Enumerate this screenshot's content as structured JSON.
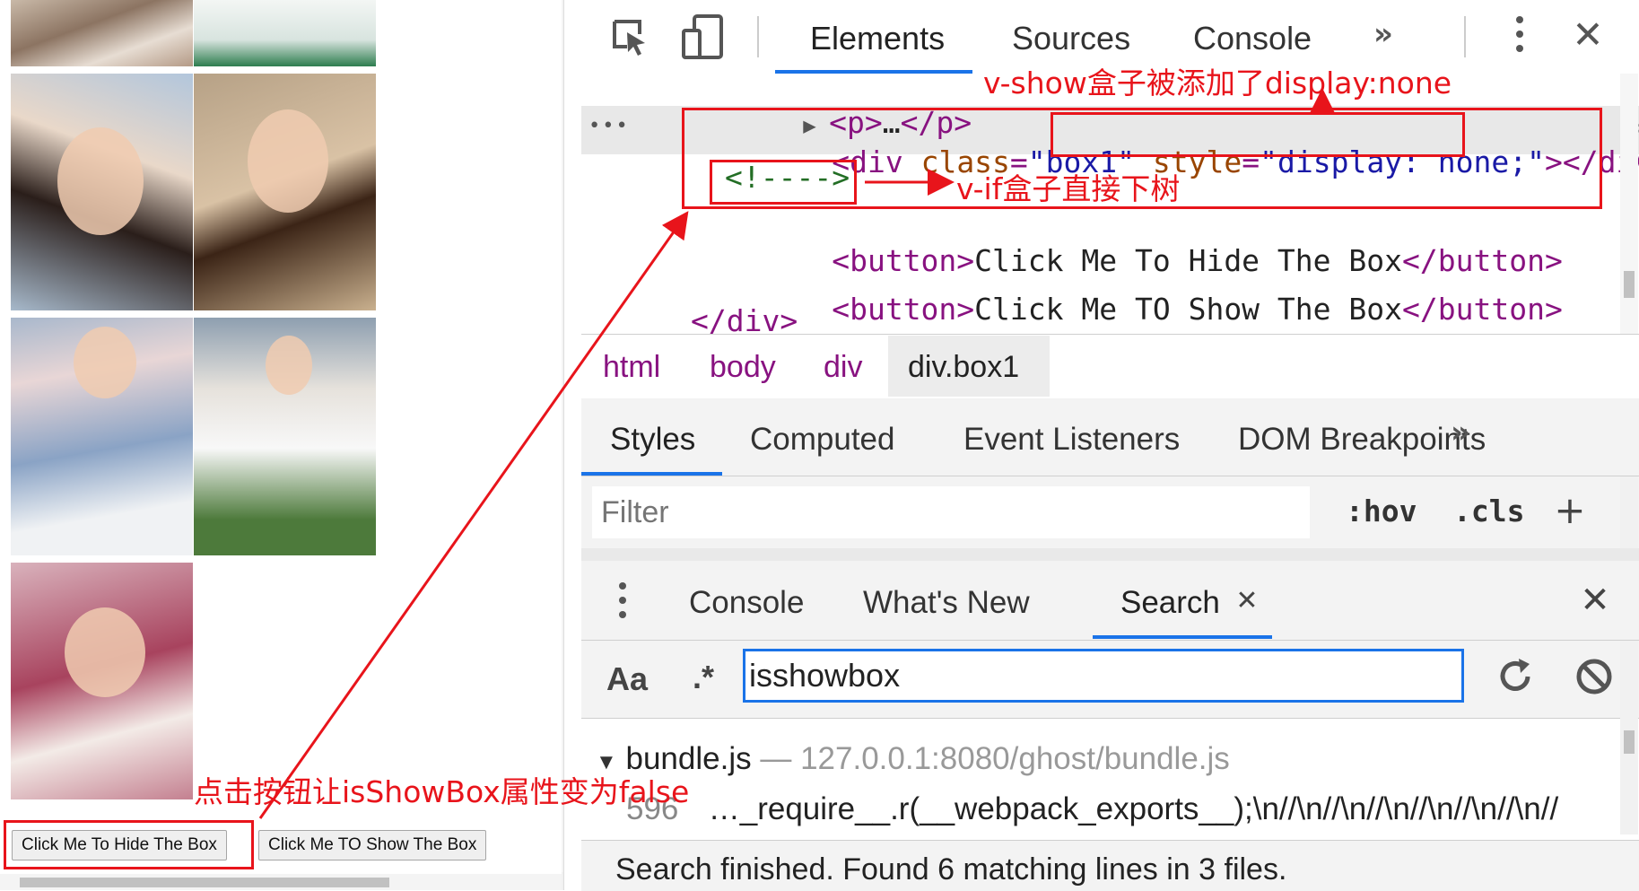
{
  "page": {
    "hide_button": "Click Me To Hide The Box",
    "show_button": "Click Me TO Show The Box"
  },
  "devtools": {
    "main_tabs": [
      "Elements",
      "Sources",
      "Console"
    ],
    "more_tabs_icon": "chevron-double-right-icon",
    "dom": {
      "p_collapsed": {
        "open": "<p>",
        "ellipsis": "…",
        "close": "</p>"
      },
      "box1": {
        "open_tag": "<div",
        "class_attr": "class",
        "class_val": "\"box1\"",
        "style_attr": "style",
        "style_val": "\"display: none;\"",
        "close": "></div>"
      },
      "comment": "<!---->",
      "buttons": [
        {
          "open": "<button>",
          "text": "Click Me To Hide The Box",
          "close": "</button>"
        },
        {
          "open": "<button>",
          "text": "Click Me TO Show The Box",
          "close": "</button>"
        }
      ],
      "div_close": "</div>",
      "row_menu": "•••"
    },
    "breadcrumbs": [
      "html",
      "body",
      "div",
      "div.box1"
    ],
    "styles_tabs": [
      "Styles",
      "Computed",
      "Event Listeners",
      "DOM Breakpoints"
    ],
    "filter": {
      "placeholder": "Filter",
      "hov": ":hov",
      "cls": ".cls",
      "add": "+"
    },
    "drawer_tabs": [
      "Console",
      "What's New",
      "Search"
    ],
    "search": {
      "case_label": "Aa",
      "regex_label": ".*",
      "query": "isshowbox",
      "file": "bundle.js",
      "separator": "—",
      "path": "127.0.0.1:8080/ghost/bundle.js",
      "line_no": "596",
      "line_text": "…_require__.r(__webpack_exports__);\\n//\\n//\\n//\\n//\\n//\\n//\\n//",
      "status": "Search finished.  Found 6 matching lines in 3 files."
    }
  },
  "annotations": {
    "vshow": "v-show盒子被添加了display:none",
    "vif": "v-if盒子直接下树",
    "click": "点击按钮让isShowBox属性变为false"
  },
  "colors": {
    "annotation_red": "#e8141b",
    "tab_blue": "#1a73e8",
    "tag_purple": "#881280"
  }
}
